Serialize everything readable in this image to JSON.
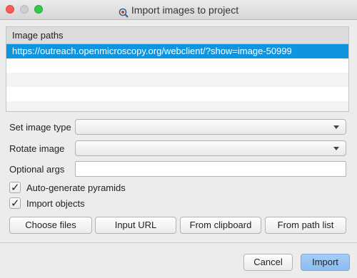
{
  "window": {
    "title": "Import images to project"
  },
  "image_list": {
    "header": "Image paths",
    "items": [
      "https://outreach.openmicroscopy.org/webclient/?show=image-50999"
    ]
  },
  "form": {
    "image_type": {
      "label": "Set image type",
      "value": ""
    },
    "rotate": {
      "label": "Rotate image",
      "value": ""
    },
    "optional_args": {
      "label": "Optional args",
      "value": ""
    }
  },
  "options": {
    "auto_pyramids": {
      "label": "Auto-generate pyramids",
      "checked": true
    },
    "import_objects": {
      "label": "Import objects",
      "checked": true
    }
  },
  "source_buttons": {
    "choose_files": "Choose files",
    "input_url": "Input URL",
    "from_clipboard": "From clipboard",
    "from_path_list": "From path list"
  },
  "dialog_buttons": {
    "cancel": "Cancel",
    "import": "Import"
  },
  "colors": {
    "selection": "#0f95df",
    "primary_button": "#8bbcef"
  },
  "icons": {
    "app": "magnifier-icon",
    "dropdown": "chevron-down-icon",
    "check": "checkmark-icon"
  }
}
